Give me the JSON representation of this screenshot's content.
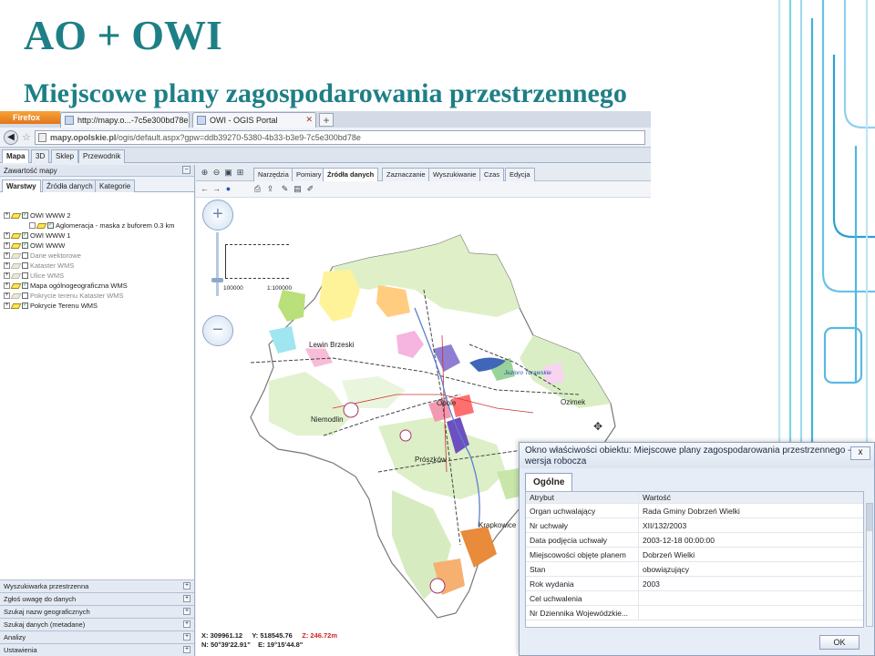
{
  "slide": {
    "title": "AO + OWI",
    "subtitle": "Miejscowe plany zagospodarowania przestrzennego"
  },
  "browser": {
    "app": "Firefox",
    "tabs": [
      {
        "label": "http://mapy.o...-7c5e300bd78e"
      },
      {
        "label": "OWI - OGIS Portal"
      }
    ],
    "new_tab": "+",
    "url_host": "mapy.opolskie.pl",
    "url_path": "/ogis/default.aspx?gpw=ddb39270-5380-4b33-b3e9-7c5e300bd78e"
  },
  "app_tabs": [
    "Mapa",
    "3D",
    "Sklep",
    "Przewodnik"
  ],
  "left_panel": {
    "header": "Zawartość mapy",
    "subtabs": [
      "Warstwy",
      "Źródła danych",
      "Kategorie"
    ],
    "layers": [
      {
        "label": "OWI WWW 2",
        "on": true,
        "dim": false,
        "indent": 0
      },
      {
        "label": "Aglomeracja - maska z buforem 0.3 km",
        "on": true,
        "dim": false,
        "indent": 1
      },
      {
        "label": "OWI WWW 1",
        "on": true,
        "dim": false,
        "indent": 0
      },
      {
        "label": "OWI WWW",
        "on": true,
        "dim": false,
        "indent": 0
      },
      {
        "label": "Dane wektorowe",
        "on": false,
        "dim": true,
        "indent": 0
      },
      {
        "label": "Kataster WMS",
        "on": false,
        "dim": true,
        "indent": 0
      },
      {
        "label": "Ulice WMS",
        "on": false,
        "dim": true,
        "indent": 0
      },
      {
        "label": "Mapa ogólnogeograficzna WMS",
        "on": true,
        "dim": false,
        "indent": 0
      },
      {
        "label": "Pokrycie terenu Kataster WMS",
        "on": false,
        "dim": true,
        "indent": 0
      },
      {
        "label": "Pokrycie Terenu WMS",
        "on": true,
        "dim": false,
        "indent": 0
      }
    ],
    "accordions": [
      "Wyszukiwarka przestrzenna",
      "Zgłoś uwagę do danych",
      "Szukaj nazw geograficznych",
      "Szukaj danych (metadane)",
      "Analizy",
      "Ustawienia"
    ]
  },
  "map": {
    "toolbar_tabs": [
      "Narzędzia",
      "Pomiary",
      "Źródła danych",
      "Zaznaczanie",
      "Wyszukiwanie",
      "Czas",
      "Edycja"
    ],
    "scale_labels": [
      "100000",
      "1:100000"
    ],
    "places": [
      "Lewin Brzeski",
      "Niemodlin",
      "Opole",
      "Ozimek",
      "Prószków",
      "Krapkowice",
      "Jezioro Turawskie"
    ],
    "coords": {
      "x": "X: 309961.12",
      "y": "Y: 518545.76",
      "z": "Z: 246.72m",
      "n": "N: 50°39'22.91\"",
      "e": "E: 19°15'44.8\""
    },
    "colors": {
      "coord_z": "#d22222"
    }
  },
  "dialog": {
    "title": "Okno właściwości obiektu: Miejscowe plany zagospodarowania przestrzennego - wersja robocza",
    "close": "x",
    "tab": "Ogólne",
    "col_attr": "Atrybut",
    "col_val": "Wartość",
    "rows": [
      {
        "a": "Organ uchwalający",
        "v": "Rada Gminy Dobrzeń Wielki"
      },
      {
        "a": "Nr uchwały",
        "v": "XII/132/2003"
      },
      {
        "a": "Data podjęcia uchwały",
        "v": "2003-12-18 00:00:00"
      },
      {
        "a": "Miejscowości objęte planem",
        "v": "Dobrzeń Wielki"
      },
      {
        "a": "Stan",
        "v": "obowiązujący"
      },
      {
        "a": "Rok wydania",
        "v": "2003"
      },
      {
        "a": "Cel uchwalenia",
        "v": ""
      },
      {
        "a": "Nr Dziennika Wojewódzkie...",
        "v": ""
      }
    ],
    "ok": "OK"
  }
}
